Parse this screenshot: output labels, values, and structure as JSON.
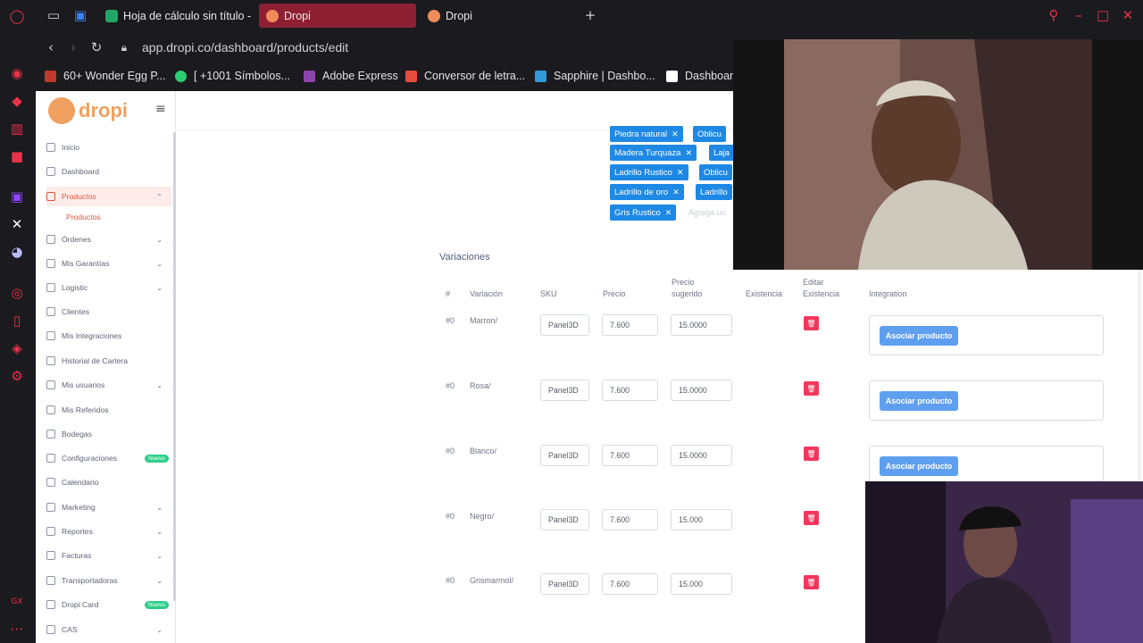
{
  "browser": {
    "tabs": [
      {
        "label": "Hoja de cálculo sin título -",
        "icon": "sheets-icon",
        "active": false
      },
      {
        "label": "Dropi",
        "icon": "dropi-icon",
        "active": true
      },
      {
        "label": "Dropi",
        "icon": "dropi-icon",
        "active": false
      }
    ],
    "url": "app.dropi.co/dashboard/products/edit",
    "bookmarks": [
      {
        "label": "60+ Wonder Egg P...",
        "color": "#c0392b"
      },
      {
        "label": "[ +1001 Símbolos...",
        "color": "#2ecc71"
      },
      {
        "label": "Adobe Express",
        "color": "#8e44ad"
      },
      {
        "label": "Conversor de letra...",
        "color": "#e74c3c"
      },
      {
        "label": "Sapphire | Dashbo...",
        "color": "#3498db"
      },
      {
        "label": "Dashboard",
        "color": "#ffffff"
      }
    ]
  },
  "app": {
    "logo_text": "dropi",
    "accent": "#e8543a",
    "sidebar": [
      {
        "label": "Inicio",
        "chev": false
      },
      {
        "label": "Dashboard",
        "chev": false
      },
      {
        "label": "Productos",
        "chev": true,
        "active": true
      },
      {
        "label": "Productos",
        "sub": true
      },
      {
        "label": "Órdenes",
        "chev": true
      },
      {
        "label": "Mis Garantías",
        "chev": true
      },
      {
        "label": "Logistic",
        "chev": true
      },
      {
        "label": "Clientes",
        "chev": false
      },
      {
        "label": "Mis Integraciones",
        "chev": false
      },
      {
        "label": "Historial de Cartera",
        "chev": false
      },
      {
        "label": "Mis usuarios",
        "chev": true
      },
      {
        "label": "Mis Referidos",
        "chev": false
      },
      {
        "label": "Bodegas",
        "chev": false
      },
      {
        "label": "Configuraciones",
        "chev": false,
        "badge": "Nuevo"
      },
      {
        "label": "Calendario",
        "chev": false
      },
      {
        "label": "Marketing",
        "chev": true
      },
      {
        "label": "Reportes",
        "chev": true
      },
      {
        "label": "Facturas",
        "chev": true
      },
      {
        "label": "Transportadoras",
        "chev": true
      },
      {
        "label": "Dropi Card",
        "chev": false,
        "badge": "Nuevo"
      },
      {
        "label": "CAS",
        "chev": true
      }
    ],
    "tags": [
      {
        "label": "Piedra natural"
      },
      {
        "label": "Oblicu"
      },
      {
        "label": "Madera Turquaza"
      },
      {
        "label": "Laja"
      },
      {
        "label": "Ladrillo Rustico"
      },
      {
        "label": "Oblicu"
      },
      {
        "label": "Ladrillo de oro"
      },
      {
        "label": "Ladrillo"
      },
      {
        "label": "Gris Rustico"
      }
    ],
    "tag_placeholder": "Agrega un",
    "variations": {
      "title": "Variaciones",
      "headers": [
        "#",
        "Variación",
        "SKU",
        "Precio",
        "Precio sugerido",
        "Existencia",
        "Editar Existencia",
        "Integration"
      ],
      "rows": [
        {
          "num": "#0",
          "name": "Marron/",
          "sku": "Panel3D",
          "price": "7.600",
          "suggested": "15.0000",
          "action": "Asociar producto"
        },
        {
          "num": "#0",
          "name": "Rosa/",
          "sku": "Panel3D",
          "price": "7.600",
          "suggested": "15.0000",
          "action": "Asociar producto"
        },
        {
          "num": "#0",
          "name": "Blanco/",
          "sku": "Panel3D",
          "price": "7.600",
          "suggested": "15.0000",
          "action": "Asociar producto"
        },
        {
          "num": "#0",
          "name": "Negro/",
          "sku": "Panel3D",
          "price": "7.600",
          "suggested": "15.000",
          "action": ""
        },
        {
          "num": "#0",
          "name": "Grismarmol/",
          "sku": "Panel3D",
          "price": "7.600",
          "suggested": "15.000",
          "action": ""
        }
      ]
    }
  }
}
